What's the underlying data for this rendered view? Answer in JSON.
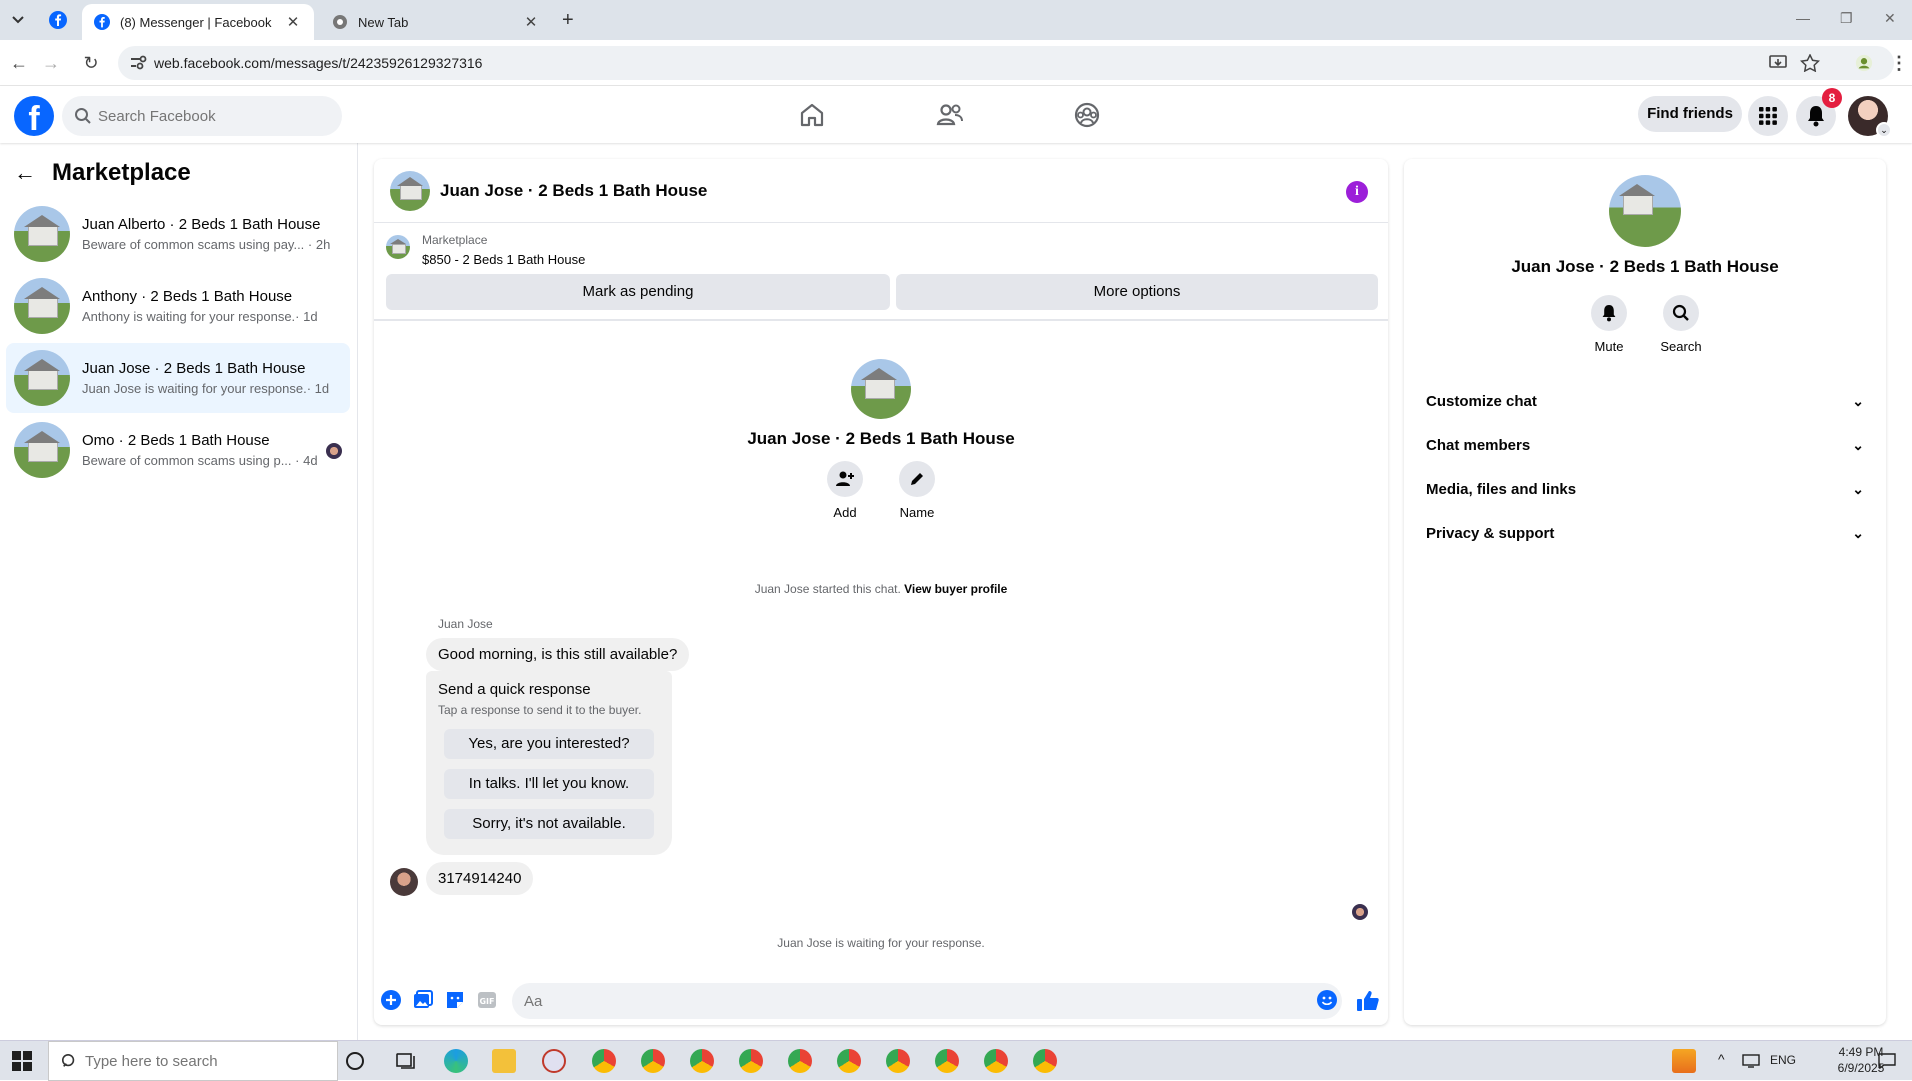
{
  "browser": {
    "tabs": [
      {
        "title": "(8) Messenger | Facebook",
        "active": true
      },
      {
        "title": "New Tab",
        "active": false
      }
    ],
    "url": "web.facebook.com/messages/t/24235926129327316"
  },
  "header": {
    "search_placeholder": "Search Facebook",
    "find_friends": "Find friends",
    "notification_count": "8",
    "brand_color": "#0866ff"
  },
  "sidebar": {
    "title": "Marketplace",
    "conversations": [
      {
        "name": "Juan Alberto · 2 Beds 1 Bath House",
        "preview": "Beware of common scams using pay...",
        "time": "· 2h",
        "selected": false
      },
      {
        "name": "Anthony · 2 Beds 1 Bath House",
        "preview": "Anthony is waiting for your response.",
        "time": "· 1d",
        "selected": false
      },
      {
        "name": "Juan Jose · 2 Beds 1 Bath House",
        "preview": "Juan Jose is waiting for your response.",
        "time": "· 1d",
        "selected": true
      },
      {
        "name": "Omo · 2 Beds 1 Bath House",
        "preview": "Beware of common scams using p...",
        "time": "· 4d",
        "selected": false
      }
    ]
  },
  "chat": {
    "title": "Juan Jose · 2 Beds 1 Bath House",
    "listing": {
      "category": "Marketplace",
      "price_title": "$850 - 2 Beds 1 Bath House",
      "mark_pending": "Mark as pending",
      "more_options": "More options"
    },
    "profile": {
      "name": "Juan Jose · 2 Beds 1 Bath House",
      "add_label": "Add",
      "name_label": "Name"
    },
    "started_text": "Juan Jose started this chat.",
    "view_buyer_profile": "View buyer profile",
    "sender_name": "Juan Jose",
    "message1": "Good morning, is this still available?",
    "quick_response": {
      "title": "Send a quick response",
      "subtitle": "Tap a response to send it to the buyer.",
      "options": [
        "Yes, are you interested?",
        "In talks. I'll let you know.",
        "Sorry, it's not available."
      ]
    },
    "message2": "3174914240",
    "waiting_text": "Juan Jose is waiting for your response.",
    "composer_placeholder": "Aa",
    "accent_color": "#0866ff"
  },
  "right_panel": {
    "name": "Juan Jose · 2 Beds 1 Bath House",
    "mute_label": "Mute",
    "search_label": "Search",
    "sections": [
      "Customize chat",
      "Chat members",
      "Media, files and links",
      "Privacy & support"
    ]
  },
  "taskbar": {
    "search_placeholder": "Type here to search",
    "language": "ENG",
    "time": "4:49 PM",
    "date": "6/9/2025"
  }
}
